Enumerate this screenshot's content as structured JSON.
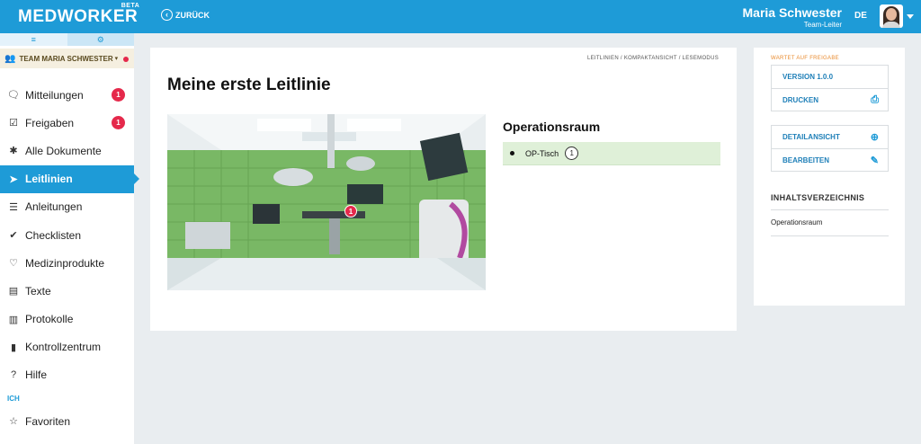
{
  "header": {
    "logo": "MEDWORKER",
    "logo_badge": "BETA",
    "back_label": "ZURÜCK",
    "user_name": "Maria Schwester",
    "user_role": "Team-Leiter",
    "language": "DE"
  },
  "sidebar": {
    "tabs": [
      {
        "icon": "≡"
      },
      {
        "icon": "⚙"
      }
    ],
    "team_label": "TEAM MARIA SCHWESTER",
    "items": [
      {
        "label": "Mitteilungen",
        "icon": "speech-bubble-icon",
        "badge": "1"
      },
      {
        "label": "Freigaben",
        "icon": "checkbox-icon",
        "badge": "1"
      },
      {
        "label": "Alle Dokumente",
        "icon": "asterisk-icon"
      },
      {
        "label": "Leitlinien",
        "icon": "send-icon",
        "active": true
      },
      {
        "label": "Anleitungen",
        "icon": "list-icon"
      },
      {
        "label": "Checklisten",
        "icon": "check-circle-icon"
      },
      {
        "label": "Medizinprodukte",
        "icon": "heartbeat-icon"
      },
      {
        "label": "Texte",
        "icon": "book-icon"
      },
      {
        "label": "Protokolle",
        "icon": "clipboard-icon"
      },
      {
        "label": "Kontrollzentrum",
        "icon": "bar-chart-icon"
      },
      {
        "label": "Hilfe",
        "icon": "question-circle-icon"
      }
    ],
    "section_label": "ICH",
    "favorites_label": "Favoriten"
  },
  "main": {
    "breadcrumb": "LEITLINIEN / KOMPAKTANSICHT / LESEMODUS",
    "title": "Meine erste Leitlinie",
    "image_marker": "1",
    "room_title": "Operationsraum",
    "room_items": [
      {
        "label": "OP-Tisch",
        "count": "1"
      }
    ]
  },
  "right_panel": {
    "status": "WARTET AUF FREIGABE",
    "version": "VERSION 1.0.0",
    "print": "DRUCKEN",
    "detail_view": "DETAILANSICHT",
    "edit": "BEARBEITEN",
    "toc_title": "INHALTSVERZEICHNIS",
    "toc_items": [
      "Operationsraum"
    ]
  },
  "colors": {
    "primary": "#1e9bd7",
    "badge": "#e5294b",
    "status": "#e98b2f",
    "room_row": "#dff0d8",
    "background": "#e9edf0"
  }
}
